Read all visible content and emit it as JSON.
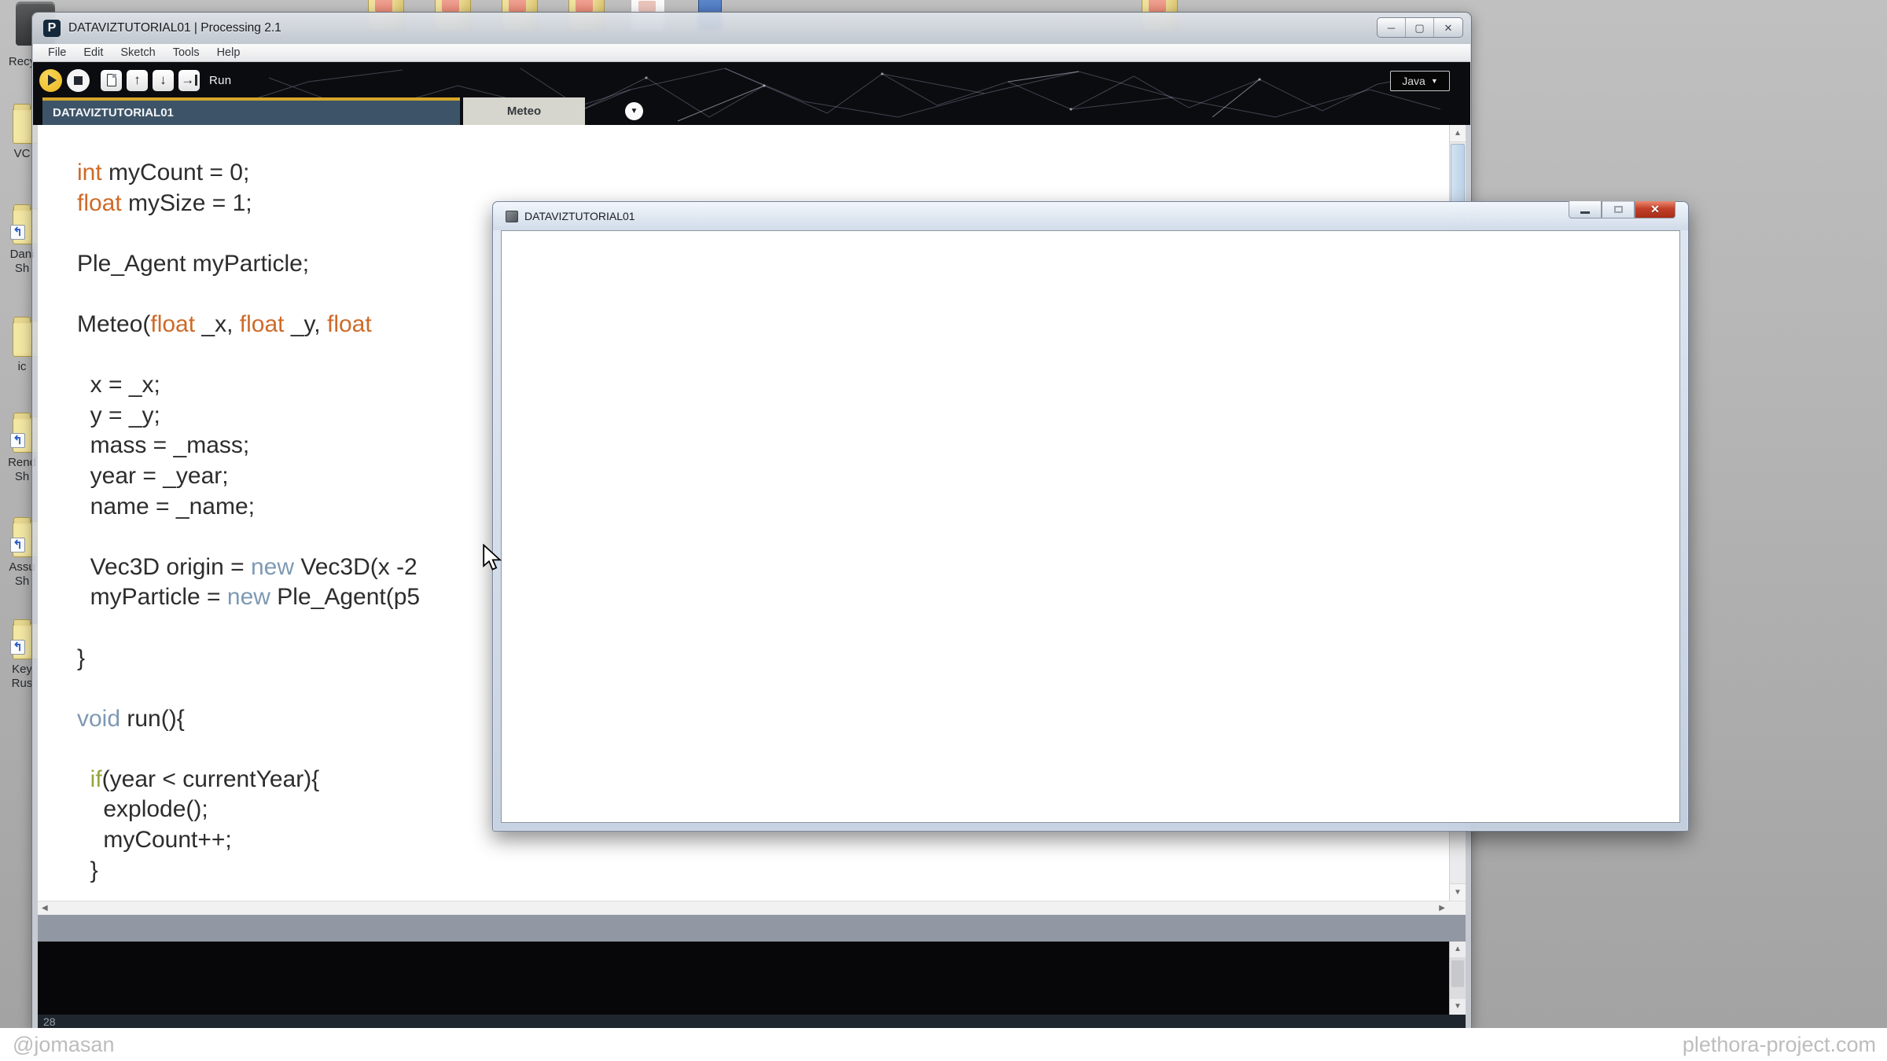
{
  "desktop": {
    "left_icons": [
      {
        "type": "recycle-bin",
        "label": "Recy"
      },
      {
        "type": "folder",
        "label": "VC"
      },
      {
        "type": "folder-shortcut",
        "label": "Dani\nSh"
      },
      {
        "type": "folder",
        "label": "ic"
      },
      {
        "type": "folder-shortcut",
        "label": "Rend\nSh"
      },
      {
        "type": "folder-shortcut",
        "label": "Assu\nSh"
      },
      {
        "type": "folder-shortcut",
        "label": "Key\nRus"
      }
    ],
    "top_icons": [
      {
        "type": "folder"
      },
      {
        "type": "folder"
      },
      {
        "type": "folder"
      },
      {
        "type": "folder"
      },
      {
        "type": "document"
      },
      {
        "type": "app"
      },
      {
        "type": "folder"
      }
    ]
  },
  "ide": {
    "title": "DATAVIZTUTORIAL01 | Processing 2.1",
    "logo_letter": "P",
    "window_buttons": {
      "minimize": "─",
      "maximize": "▢",
      "close": "✕"
    },
    "menu": [
      "File",
      "Edit",
      "Sketch",
      "Tools",
      "Help"
    ],
    "toolbar": {
      "run_label": "Run",
      "mode_label": "Java",
      "buttons": [
        "run",
        "stop",
        "new-sketch",
        "open-sketch",
        "save-sketch",
        "export"
      ]
    },
    "tabs": [
      {
        "label": "DATAVIZTUTORIAL01",
        "active": true
      },
      {
        "label": "Meteo",
        "active": false
      }
    ],
    "editor": {
      "lines": [
        [
          {
            "c": "type",
            "t": "int"
          },
          {
            "t": " myCount = 0;"
          }
        ],
        [
          {
            "c": "type",
            "t": "float"
          },
          {
            "t": " mySize = 1;"
          }
        ],
        [],
        [
          {
            "t": "Ple_Agent myParticle;"
          }
        ],
        [],
        [
          {
            "t": "Meteo("
          },
          {
            "c": "type",
            "t": "float"
          },
          {
            "t": " _x, "
          },
          {
            "c": "type",
            "t": "float"
          },
          {
            "t": " _y, "
          },
          {
            "c": "type",
            "t": "float"
          }
        ],
        [],
        [
          {
            "t": "  x = _x;"
          }
        ],
        [
          {
            "t": "  y = _y;"
          }
        ],
        [
          {
            "t": "  mass = _mass;"
          }
        ],
        [
          {
            "t": "  year = _year;"
          }
        ],
        [
          {
            "t": "  name = _name;"
          }
        ],
        [],
        [
          {
            "t": "  Vec3D origin = "
          },
          {
            "c": "kw",
            "t": "new"
          },
          {
            "t": " Vec3D(x -2"
          }
        ],
        [
          {
            "t": "  myParticle = "
          },
          {
            "c": "kw",
            "t": "new"
          },
          {
            "t": " Ple_Agent(p5"
          }
        ],
        [],
        [
          {
            "t": "}"
          }
        ],
        [],
        [
          {
            "c": "kw",
            "t": "void"
          },
          {
            "t": " run(){"
          }
        ],
        [],
        [
          {
            "t": "  "
          },
          {
            "c": "cond",
            "t": "if"
          },
          {
            "t": "(year < currentYear){"
          }
        ],
        [
          {
            "t": "    explode();"
          }
        ],
        [
          {
            "t": "    myCount++;"
          }
        ],
        [
          {
            "t": "  }"
          }
        ]
      ]
    },
    "status_line_number": "28"
  },
  "sketch_window": {
    "title": "DATAVIZTUTORIAL01",
    "close_glyph": "✕"
  },
  "watermarks": {
    "left": "@jomasan",
    "right": "plethora-project.com"
  },
  "colors": {
    "run_button_yellow": "#EDB81F",
    "tab_active_bg": "#3D5468",
    "tab_accent_line": "#D4A62A",
    "keyword_type_orange": "#CE6A28",
    "keyword_new_blue": "#7E99B3",
    "keyword_if_green": "#93A73C",
    "close_button_red": "#C2402A",
    "console_black": "#070709",
    "message_band_gray": "#9198A3"
  }
}
